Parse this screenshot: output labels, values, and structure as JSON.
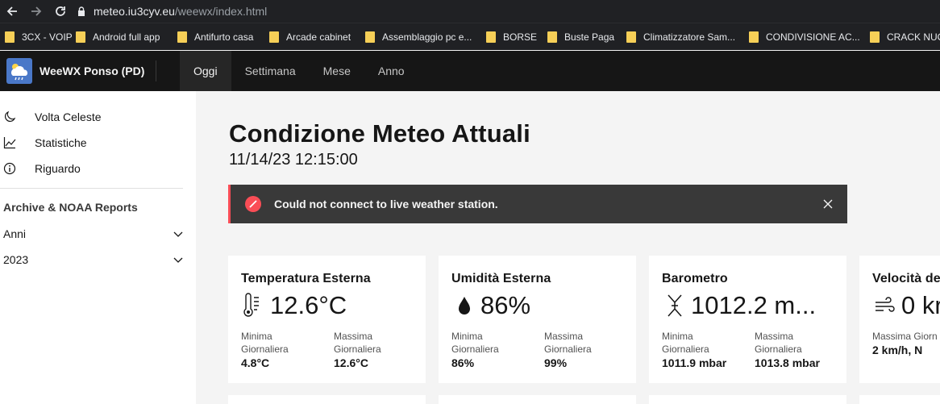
{
  "browser": {
    "url_host": "meteo.iu3cyv.eu",
    "url_path": "/weewx/index.html",
    "bookmarks": [
      "3CX - VOIP",
      "Android full app",
      "Antifurto casa",
      "Arcade cabinet",
      "Assemblaggio pc e...",
      "BORSE",
      "Buste Paga",
      "Climatizzatore Sam...",
      "CONDIVISIONE AC...",
      "CRACK NUO"
    ]
  },
  "header": {
    "brand": "WeeWX Ponso (PD)",
    "tabs": [
      "Oggi",
      "Settimana",
      "Mese",
      "Anno"
    ],
    "active_tab": "Oggi"
  },
  "sidebar": {
    "items": [
      {
        "label": "Volta Celeste",
        "icon": "moon-icon"
      },
      {
        "label": "Statistiche",
        "icon": "chart-line-icon"
      },
      {
        "label": "Riguardo",
        "icon": "info-icon"
      }
    ],
    "archive_heading": "Archive & NOAA Reports",
    "expanders": [
      "Anni",
      "2023"
    ]
  },
  "main": {
    "title": "Condizione Meteo Attuali",
    "timestamp": "11/14/23 12:15:00",
    "notice": "Could not connect to live weather station."
  },
  "cards": [
    {
      "title": "Temperatura Esterna",
      "icon": "thermometer-icon",
      "value": "12.6°C",
      "min_label": "Minima Giornaliera",
      "min_value": "4.8°C",
      "max_label": "Massima Giornaliera",
      "max_value": "12.6°C"
    },
    {
      "title": "Umidità Esterna",
      "icon": "droplet-icon",
      "value": "86%",
      "min_label": "Minima Giornaliera",
      "min_value": "86%",
      "max_label": "Massima Giornaliera",
      "max_value": "99%"
    },
    {
      "title": "Barometro",
      "icon": "pressure-icon",
      "value": "1012.2 m...",
      "min_label": "Minima Giornaliera",
      "min_value": "1011.9 mbar",
      "max_label": "Massima Giornaliera",
      "max_value": "1013.8 mbar"
    },
    {
      "title": "Velocità de",
      "icon": "wind-icon",
      "value": "0 kr",
      "max_label": "Massima Giorn",
      "max_value": "2 km/h, N"
    }
  ],
  "colors": {
    "header_bg": "#161616",
    "notice_accent": "#fa4d56",
    "folder": "#f6cf57"
  }
}
